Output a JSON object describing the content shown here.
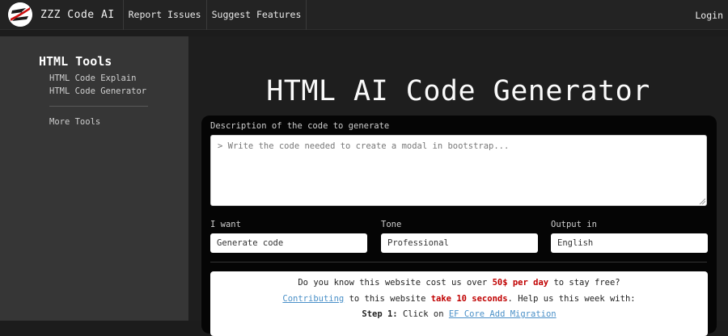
{
  "navbar": {
    "brand": "ZZZ Code AI",
    "links": [
      "Report Issues",
      "Suggest Features"
    ],
    "login": "Login"
  },
  "sidebar": {
    "title": "HTML Tools",
    "items": [
      "HTML Code Explain",
      "HTML Code Generator"
    ],
    "more": "More Tools"
  },
  "main": {
    "title": "HTML AI Code Generator",
    "description_label": "Description of the code to generate",
    "description_placeholder": "> Write the code needed to create a modal in bootstrap...",
    "want_label": "I want",
    "want_value": "Generate code",
    "tone_label": "Tone",
    "tone_value": "Professional",
    "output_label": "Output in",
    "output_value": "English"
  },
  "notice": {
    "line1_a": "Do you know this website cost us over ",
    "line1_b": "50$ per day",
    "line1_c": " to stay free?",
    "line2_link": "Contributing",
    "line2_a": " to this website ",
    "line2_b": "take 10 seconds",
    "line2_c": ". Help us this week with:",
    "line3_step": "Step 1:",
    "line3_a": " Click on ",
    "line3_link": "EF Core Add Migration"
  },
  "colors": {
    "accent_red": "#c00000",
    "link": "#4a90c8"
  }
}
